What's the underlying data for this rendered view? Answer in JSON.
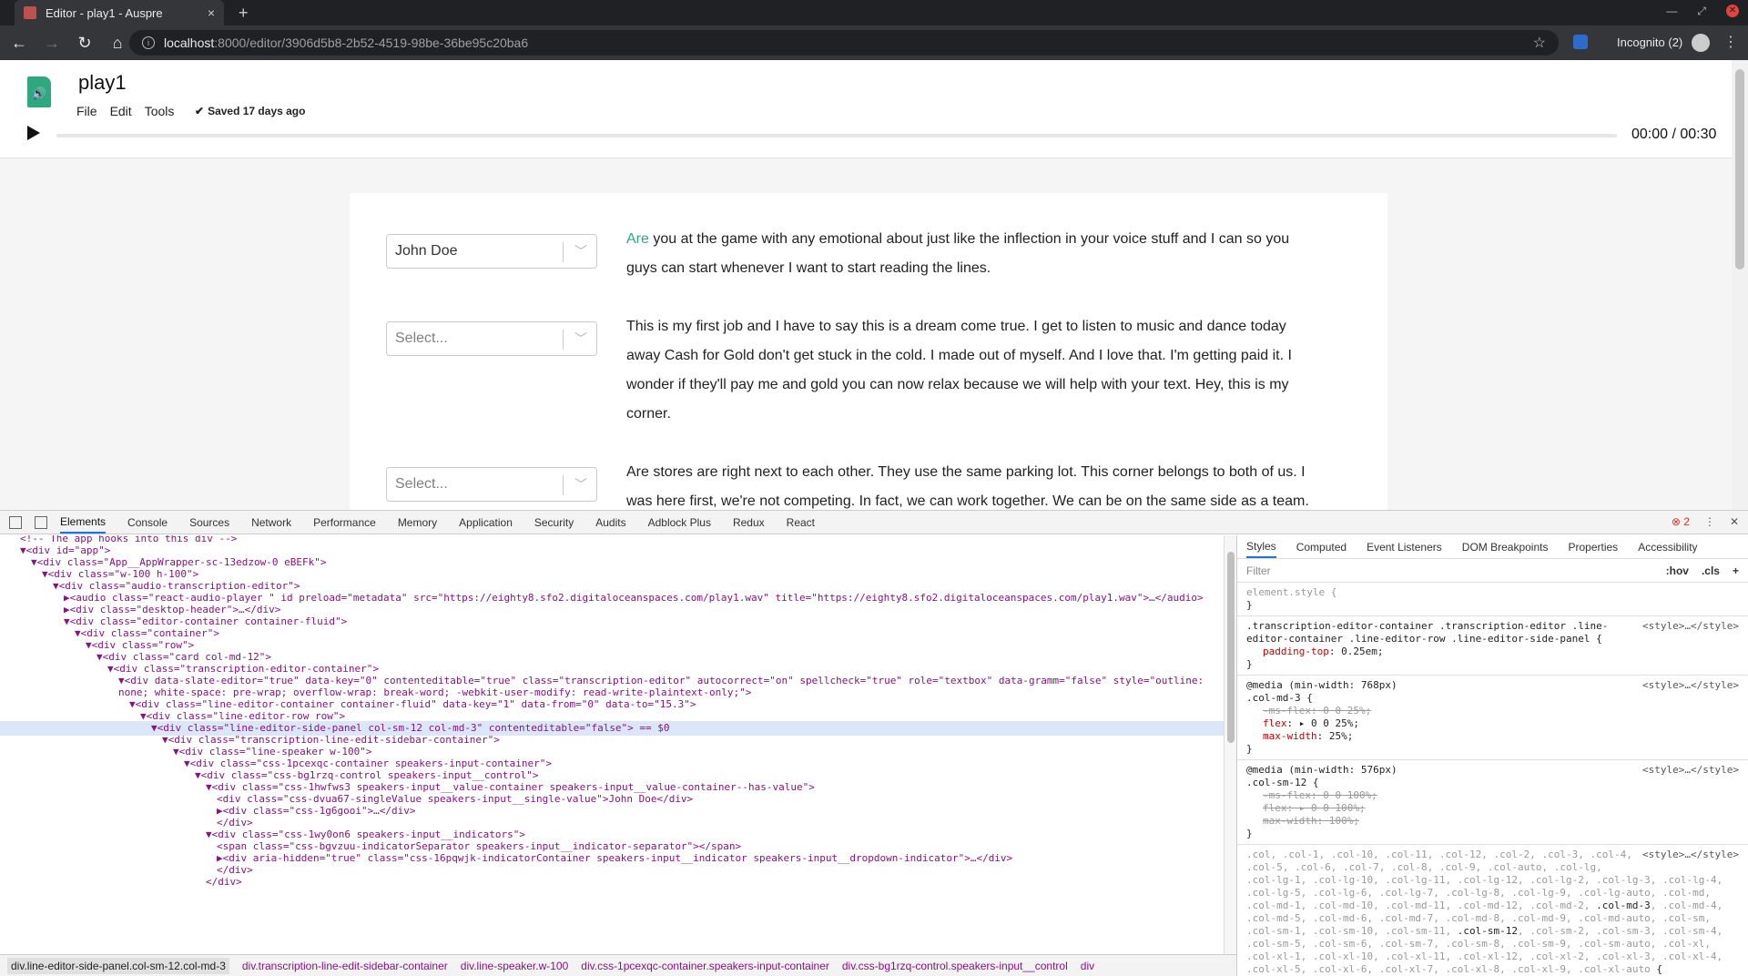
{
  "browser": {
    "tab_title": "Editor - play1 - Auspre",
    "tab_close": "×",
    "new_tab": "+",
    "url_host": "localhost",
    "url_path": ":8000/editor/3906d5b8-2b52-4519-98be-36be95c20ba6",
    "incognito": "Incognito (2)"
  },
  "app": {
    "doc_title": "play1",
    "menu": [
      "File",
      "Edit",
      "Tools"
    ],
    "saved": "Saved 17 days ago",
    "time": "00:00 / 00:30",
    "progress": 0.0
  },
  "lines": [
    {
      "speaker": "John Doe",
      "placeholder": false,
      "highlight": "Are",
      "text": " you at the game with any emotional about just like the inflection in your voice stuff and I can so you guys can start whenever I want to start reading the lines."
    },
    {
      "speaker": "Select...",
      "placeholder": true,
      "highlight": "",
      "text": "This is my first job and I have to say this is a dream come true. I get to listen to music and dance today away Cash for Gold don't get stuck in the cold. I made out of myself. And I love that. I'm getting paid it. I wonder if they'll pay me and gold you can now relax because we will help with your text. Hey, this is my corner."
    },
    {
      "speaker": "Select...",
      "placeholder": true,
      "highlight": "",
      "text": "Are stores are right next to each other. They use the same parking lot. This corner belongs to both of us. I was here first, we're not competing. In fact, we can work together. We can be on the same side as a team."
    }
  ],
  "devtools": {
    "tabs": [
      "Elements",
      "Console",
      "Sources",
      "Network",
      "Performance",
      "Memory",
      "Application",
      "Security",
      "Audits",
      "Adblock Plus",
      "Redux",
      "React"
    ],
    "errors": "2",
    "dom_lines": [
      {
        "indent": 0,
        "text": "<!-- The app hooks into this div -->"
      },
      {
        "indent": 0,
        "text": "▼<div id=\"app\">"
      },
      {
        "indent": 1,
        "text": "▼<div class=\"App__AppWrapper-sc-13edzow-0 eBEFk\">"
      },
      {
        "indent": 2,
        "text": "▼<div class=\"w-100 h-100\">"
      },
      {
        "indent": 3,
        "text": "▼<div class=\"audio-transcription-editor\">"
      },
      {
        "indent": 4,
        "text": "▶<audio class=\"react-audio-player \" id preload=\"metadata\" src=\"https://eighty8.sfo2.digitaloceanspaces.com/play1.wav\" title=\"https://eighty8.sfo2.digitaloceanspaces.com/play1.wav\">…</audio>"
      },
      {
        "indent": 4,
        "text": "▶<div class=\"desktop-header\">…</div>"
      },
      {
        "indent": 4,
        "text": "▼<div class=\"editor-container container-fluid\">"
      },
      {
        "indent": 5,
        "text": "▼<div class=\"container\">"
      },
      {
        "indent": 6,
        "text": "▼<div class=\"row\">"
      },
      {
        "indent": 7,
        "text": "▼<div class=\"card col-md-12\">"
      },
      {
        "indent": 8,
        "text": "▼<div class=\"transcription-editor-container\">"
      },
      {
        "indent": 9,
        "text": "▼<div data-slate-editor=\"true\" data-key=\"0\" contenteditable=\"true\" class=\"transcription-editor\" autocorrect=\"on\" spellcheck=\"true\" role=\"textbox\" data-gramm=\"false\" style=\"outline:"
      },
      {
        "indent": 9,
        "text": "none; white-space: pre-wrap; overflow-wrap: break-word; -webkit-user-modify: read-write-plaintext-only;\">"
      },
      {
        "indent": 10,
        "text": "▼<div class=\"line-editor-container container-fluid\" data-key=\"1\" data-from=\"0\" data-to=\"15.3\">"
      },
      {
        "indent": 11,
        "text": "▼<div class=\"line-editor-row row\">"
      },
      {
        "indent": 12,
        "text": "▼<div class=\"line-editor-side-panel col-sm-12 col-md-3\" contenteditable=\"false\"> == $0"
      },
      {
        "indent": 13,
        "text": "▼<div class=\"transcription-line-edit-sidebar-container\">"
      },
      {
        "indent": 14,
        "text": "▼<div class=\"line-speaker w-100\">"
      },
      {
        "indent": 15,
        "text": "▼<div class=\"css-1pcexqc-container speakers-input-container\">"
      },
      {
        "indent": 16,
        "text": "▼<div class=\"css-bg1rzq-control speakers-input__control\">"
      },
      {
        "indent": 17,
        "text": "▼<div class=\"css-1hwfws3 speakers-input__value-container speakers-input__value-container--has-value\">"
      },
      {
        "indent": 18,
        "text": "<div class=\"css-dvua67-singleValue speakers-input__single-value\">John Doe</div>"
      },
      {
        "indent": 18,
        "text": "▶<div class=\"css-1g6gooi\">…</div>"
      },
      {
        "indent": 18,
        "text": "</div>"
      },
      {
        "indent": 17,
        "text": "▼<div class=\"css-1wy0on6 speakers-input__indicators\">"
      },
      {
        "indent": 18,
        "text": "<span class=\"css-bgvzuu-indicatorSeparator speakers-input__indicator-separator\"></span>"
      },
      {
        "indent": 18,
        "text": "▶<div aria-hidden=\"true\" class=\"css-16pqwjk-indicatorContainer speakers-input__indicator speakers-input__dropdown-indicator\">…</div>"
      },
      {
        "indent": 18,
        "text": "</div>"
      },
      {
        "indent": 17,
        "text": "</div>"
      }
    ],
    "breadcrumbs": [
      "div.line-editor-side-panel.col-sm-12.col-md-3",
      "div.transcription-line-edit-sidebar-container",
      "div.line-speaker.w-100",
      "div.css-1pcexqc-container.speakers-input-container",
      "div.css-bg1rzq-control.speakers-input__control",
      "div"
    ],
    "style_tabs": [
      "Styles",
      "Computed",
      "Event Listeners",
      "DOM Breakpoints",
      "Properties",
      "Accessibility"
    ],
    "filter_placeholder": "Filter",
    "filter_buttons": [
      ":hov",
      ".cls",
      "+"
    ],
    "style_src": "<style>…</style>"
  }
}
